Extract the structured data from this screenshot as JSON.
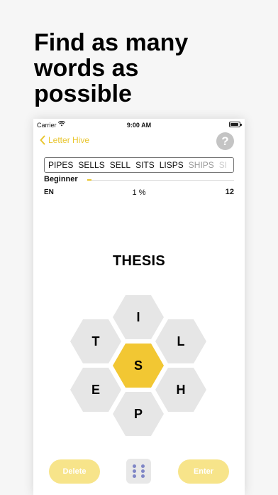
{
  "headline": {
    "line1": "Find as many",
    "line2": "words as",
    "line3": "possible"
  },
  "status_bar": {
    "carrier": "Carrier",
    "time": "9:00 AM"
  },
  "nav": {
    "back_label": "Letter Hive",
    "help_label": "?"
  },
  "found_words": [
    {
      "word": "PIPES",
      "style": "normal"
    },
    {
      "word": "SELLS",
      "style": "normal"
    },
    {
      "word": "SELL",
      "style": "normal"
    },
    {
      "word": "SITS",
      "style": "normal"
    },
    {
      "word": "LISPS",
      "style": "normal"
    },
    {
      "word": "SHIPS",
      "style": "faded-1"
    },
    {
      "word": "SI",
      "style": "faded-2"
    }
  ],
  "progress": {
    "rank": "Beginner",
    "fraction": 0.03,
    "language": "EN",
    "percent": "1 %",
    "score": "12"
  },
  "current_word": "THESIS",
  "hive": {
    "top": "I",
    "upper_left": "T",
    "upper_right": "L",
    "center": "S",
    "lower_left": "E",
    "lower_right": "H",
    "bottom": "P"
  },
  "controls": {
    "delete_label": "Delete",
    "enter_label": "Enter"
  },
  "colors": {
    "accent": "#f2c733",
    "button_light": "#f7e48a",
    "hex_grey": "#e6e6e6",
    "dice_dots": "#7f86c6"
  }
}
